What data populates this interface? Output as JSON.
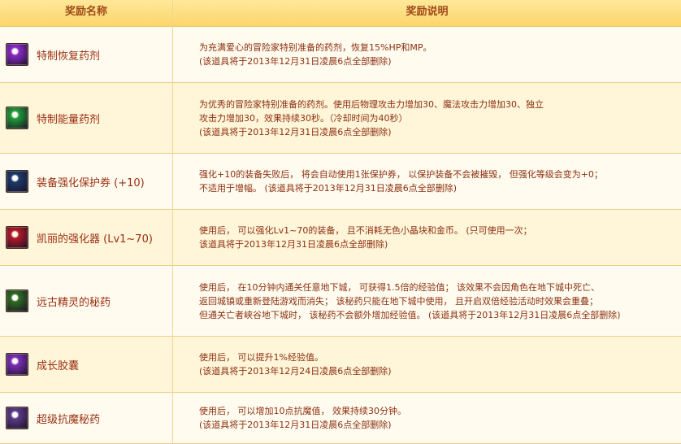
{
  "header": {
    "col_name": "奖励名称",
    "col_desc": "奖励说明"
  },
  "items": [
    {
      "name": "特制恢复药剂",
      "icon": "purple-potion-icon",
      "lines": [
        "为充满爱心的冒险家特别准备的药剂，恢复15%HP和MP。",
        "(该道具将于2013年12月31日凌晨6点全部删除)"
      ]
    },
    {
      "name": "特制能量药剂",
      "icon": "green-potion-icon",
      "lines": [
        "为优秀的冒险家特别准备的药剂。使用后物理攻击力增加30、魔法攻击力增加30、独立",
        "攻击力增加30，效果持续30秒。（冷却时间为40秒）",
        "(该道具将于2013年12月31日凌晨6点全部删除)"
      ]
    },
    {
      "name": "装备强化保护券 (+10)",
      "icon": "protection-ticket-icon",
      "lines": [
        "强化+10的装备失败后， 将会自动使用1张保护券， 以保护装备不会被摧毁， 但强化等级会变为+0；",
        "不适用于增幅。 (该道具将于2013年12月31日凌晨6点全部删除)"
      ]
    },
    {
      "name": "凯丽的强化器 (Lv1~70)",
      "icon": "enhancer-icon",
      "lines": [
        "使用后， 可以强化Lv1~70的装备， 且不消耗无色小晶块和金币。 (只可使用一次；",
        "该道具将于2013年12月31日凌晨6点全部删除)"
      ]
    },
    {
      "name": "远古精灵的秘药",
      "icon": "exp-elixir-icon",
      "lines": [
        "使用后， 在10分钟内通关任意地下城， 可获得1.5倍的经验值； 该效果不会因角色在地下城中死亡、",
        "返回城镇或重新登陆游戏而消失； 该秘药只能在地下城中使用， 且开启双倍经验活动时效果会重叠；",
        "但通关亡者峡谷地下城时， 该秘药不会额外增加经验值。 (该道具将于2013年12月31日凌晨6点全部删除)"
      ]
    },
    {
      "name": "成长胶囊",
      "icon": "exp-capsule-icon",
      "lines": [
        "使用后， 可以提升1%经验值。",
        "(该道具将于2013年12月24日凌晨6点全部删除)"
      ]
    },
    {
      "name": "超级抗魔秘药",
      "icon": "anti-magic-potion-icon",
      "lines": [
        "使用后， 可以增加10点抗魔值， 效果持续30分钟。",
        "(该道具将于2013年12月31日凌晨6点全部删除)"
      ]
    }
  ],
  "icon_colors": {
    "purple-potion-icon": "#8a2bc8",
    "green-potion-icon": "#1f9a3a",
    "protection-ticket-icon": "#1c3a6a",
    "enhancer-icon": "#b21a2a",
    "exp-elixir-icon": "#2f6b22",
    "exp-capsule-icon": "#7a2fb8",
    "anti-magic-potion-icon": "#5a3a8a"
  }
}
